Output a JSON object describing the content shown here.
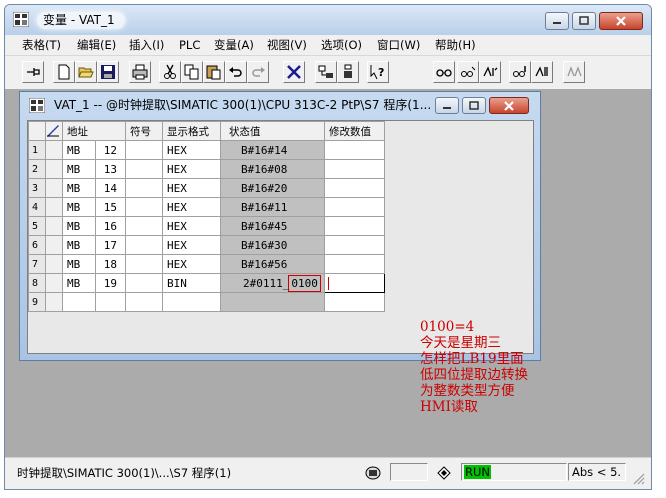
{
  "window": {
    "title": "变量 - VAT_1"
  },
  "menu": [
    "表格(T)",
    "编辑(E)",
    "插入(I)",
    "PLC",
    "变量(A)",
    "视图(V)",
    "选项(O)",
    "窗口(W)",
    "帮助(H)"
  ],
  "toolbar": {
    "icons": [
      "pin-icon",
      "new-file-icon",
      "open-folder-icon",
      "save-icon",
      "print-icon",
      "cut-icon",
      "copy-icon",
      "paste-icon",
      "undo-icon",
      "redo-icon",
      "delete-icon",
      "monitor-icon",
      "modify-icon",
      "help-icon",
      "glasses-icon",
      "monitor-var-icon",
      "modify-var-icon",
      "update-icon",
      "trigger-icon",
      "force-icon"
    ]
  },
  "child": {
    "title": "VAT_1 -- @时钟提取\\SIMATIC 300(1)\\CPU 313C-2 PtP\\S7 程序(1...",
    "columns": [
      "地址",
      "符号",
      "显示格式",
      "状态值",
      "修改数值"
    ],
    "rows": [
      {
        "n": "1",
        "area": "MB",
        "num": "12",
        "fmt": "HEX",
        "val": "B#16#14"
      },
      {
        "n": "2",
        "area": "MB",
        "num": "13",
        "fmt": "HEX",
        "val": "B#16#08"
      },
      {
        "n": "3",
        "area": "MB",
        "num": "14",
        "fmt": "HEX",
        "val": "B#16#20"
      },
      {
        "n": "4",
        "area": "MB",
        "num": "15",
        "fmt": "HEX",
        "val": "B#16#11"
      },
      {
        "n": "5",
        "area": "MB",
        "num": "16",
        "fmt": "HEX",
        "val": "B#16#45"
      },
      {
        "n": "6",
        "area": "MB",
        "num": "17",
        "fmt": "HEX",
        "val": "B#16#30"
      },
      {
        "n": "7",
        "area": "MB",
        "num": "18",
        "fmt": "HEX",
        "val": "B#16#56"
      },
      {
        "n": "8",
        "area": "MB",
        "num": "19",
        "fmt": "BIN",
        "val_a": "2#0111_",
        "val_b": "0100"
      },
      {
        "n": "9"
      }
    ]
  },
  "annotation": [
    "0100=4",
    "今天是星期三",
    "怎样把LB19里面",
    "低四位提取边转换",
    "为整数类型方便",
    "HMI读取"
  ],
  "status": {
    "path": "时钟提取\\SIMATIC 300(1)\\...\\S7 程序(1)",
    "run": "RUN",
    "abs": "Abs < 5."
  },
  "colors": {
    "annotation": "#cc0000",
    "run_bg": "#00c000",
    "status_cell": "#c0c0c0"
  }
}
